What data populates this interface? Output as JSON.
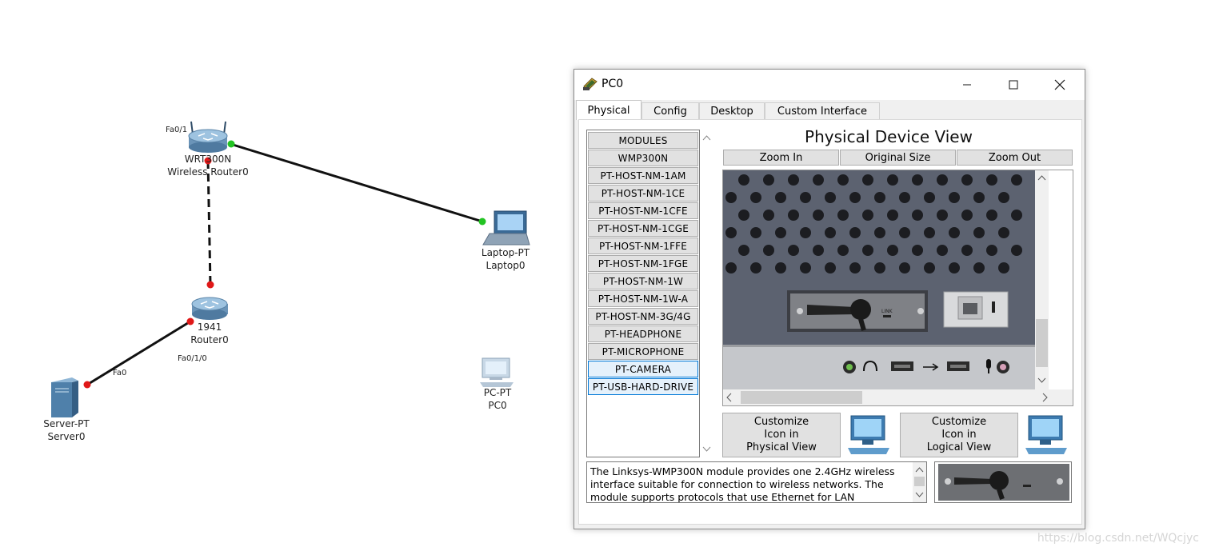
{
  "canvas": {
    "devices": [
      {
        "id": "router-wireless",
        "model": "WRT300N",
        "name": "Wireless Router0"
      },
      {
        "id": "router-1941",
        "model": "1941",
        "name": "Router0"
      },
      {
        "id": "laptop",
        "model": "Laptop-PT",
        "name": "Laptop0"
      },
      {
        "id": "server",
        "model": "Server-PT",
        "name": "Server0"
      },
      {
        "id": "pc",
        "model": "PC-PT",
        "name": "PC0"
      }
    ],
    "port_labels": {
      "wrt_fa": "Fa0/1",
      "router_fa": "Fa0/1/0",
      "server_fa": "Fa0"
    }
  },
  "window": {
    "title": "PC0",
    "tabs": [
      "Physical",
      "Config",
      "Desktop",
      "Custom Interface"
    ],
    "active_tab": "Physical"
  },
  "modules": {
    "header": "MODULES",
    "items": [
      "WMP300N",
      "PT-HOST-NM-1AM",
      "PT-HOST-NM-1CE",
      "PT-HOST-NM-1CFE",
      "PT-HOST-NM-1CGE",
      "PT-HOST-NM-1FFE",
      "PT-HOST-NM-1FGE",
      "PT-HOST-NM-1W",
      "PT-HOST-NM-1W-A",
      "PT-HOST-NM-3G/4G",
      "PT-HEADPHONE",
      "PT-MICROPHONE",
      "PT-CAMERA",
      "PT-USB-HARD-DRIVE"
    ],
    "selected": [
      "PT-CAMERA",
      "PT-USB-HARD-DRIVE"
    ]
  },
  "physical_view": {
    "title": "Physical Device View",
    "zoom_in": "Zoom In",
    "original_size": "Original Size",
    "zoom_out": "Zoom Out",
    "slot_label": "LINK"
  },
  "customize": {
    "physical": [
      "Customize",
      "Icon in",
      "Physical View"
    ],
    "logical": [
      "Customize",
      "Icon in",
      "Logical View"
    ]
  },
  "description": {
    "lines": [
      "The Linksys-WMP300N module provides one 2.4GHz wireless",
      "interface suitable for connection to wireless networks. The",
      "module supports protocols that use Ethernet for LAN"
    ]
  },
  "watermark": "https://blog.csdn.net/WQcjyc",
  "colors": {
    "link_up": "#22c322",
    "link_down": "#e01818",
    "panel": "#5c6270"
  }
}
